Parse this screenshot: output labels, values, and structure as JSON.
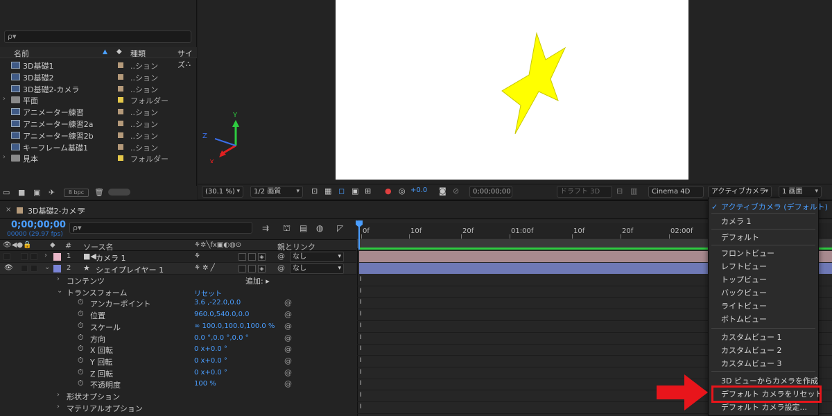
{
  "project": {
    "search_icon": "ρ▾",
    "columns": {
      "name": "名前",
      "type": "種類",
      "size": "サイズ"
    },
    "items": [
      {
        "name": "3D基礎1",
        "type": "..ション",
        "icon": "comp",
        "label_color": "#b59a7a"
      },
      {
        "name": "3D基礎2",
        "type": "..ション",
        "icon": "comp",
        "label_color": "#b59a7a"
      },
      {
        "name": "3D基礎2-カメラ",
        "type": "..ション",
        "icon": "comp",
        "label_color": "#b59a7a"
      },
      {
        "name": "平面",
        "type": "フォルダー",
        "icon": "folder",
        "label_color": "#e6c94a"
      },
      {
        "name": "アニメーター練習",
        "type": "..ション",
        "icon": "comp",
        "label_color": "#b59a7a"
      },
      {
        "name": "アニメーター練習2a",
        "type": "..ション",
        "icon": "comp",
        "label_color": "#b59a7a"
      },
      {
        "name": "アニメーター練習2b",
        "type": "..ション",
        "icon": "comp",
        "label_color": "#b59a7a"
      },
      {
        "name": "キーフレーム基礎1",
        "type": "..ション",
        "icon": "comp",
        "label_color": "#b59a7a"
      },
      {
        "name": "見本",
        "type": "フォルダー",
        "icon": "folder",
        "label_color": "#e6c94a"
      }
    ],
    "bpc": "8 bpc"
  },
  "viewer": {
    "axis_y": "Y",
    "axis_z": "Z",
    "axis_x": "X",
    "zoom": "(30.1 %)",
    "resolution": "1/2 画質",
    "exposure": "+0.0",
    "timecode": "0;00;00;00",
    "draft3d": "ドラフト 3D",
    "renderer": "Cinema 4D",
    "camera": "アクティブカメラ",
    "views": "1 画面"
  },
  "timeline": {
    "tab_title": "3D基礎2-カメラ",
    "timecode": "0;00;00;00",
    "fps": "00000 (29.97 fps)",
    "search_icon": "ρ▾",
    "header": {
      "source_name": "ソース名",
      "parent_link": "親とリンク",
      "num": "#"
    },
    "layers": [
      {
        "num": "1",
        "name": "カメラ 1",
        "icon": "■◀",
        "label_color": "#e9b7c8",
        "parent": "なし"
      },
      {
        "num": "2",
        "name": "シェイプレイヤー 1",
        "icon": "★",
        "label_color": "#7a84d6",
        "parent": "なし"
      }
    ],
    "props": [
      {
        "name": "コンテンツ",
        "indent": 1,
        "value": "",
        "add": "追加:"
      },
      {
        "name": "トランスフォーム",
        "indent": 1,
        "value": "リセット",
        "open": true
      },
      {
        "name": "アンカーポイント",
        "indent": 2,
        "value": "3.6 ,-22.0,0.0",
        "watch": true
      },
      {
        "name": "位置",
        "indent": 2,
        "value": "960.0,540.0,0.0",
        "watch": true
      },
      {
        "name": "スケール",
        "indent": 2,
        "value": "∞ 100.0,100.0,100.0 %",
        "watch": true
      },
      {
        "name": "方向",
        "indent": 2,
        "value": "0.0 °,0.0 °,0.0 °",
        "watch": true
      },
      {
        "name": "X 回転",
        "indent": 2,
        "value": "0 x+0.0 °",
        "watch": true
      },
      {
        "name": "Y 回転",
        "indent": 2,
        "value": "0 x+0.0 °",
        "watch": true
      },
      {
        "name": "Z 回転",
        "indent": 2,
        "value": "0 x+0.0 °",
        "watch": true
      },
      {
        "name": "不透明度",
        "indent": 2,
        "value": "100 %",
        "watch": true
      },
      {
        "name": "形状オプション",
        "indent": 1,
        "value": ""
      },
      {
        "name": "マテリアルオプション",
        "indent": 1,
        "value": ""
      }
    ],
    "ruler": [
      "0f",
      "10f",
      "20f",
      "01:00f",
      "10f",
      "20f",
      "02:00f"
    ]
  },
  "menu": {
    "items": [
      {
        "label": "アクティブカメラ (デフォルト)",
        "selected": true
      },
      {
        "label": "カメラ 1"
      },
      {
        "label": "デフォルト"
      },
      {
        "label": "フロントビュー"
      },
      {
        "label": "レフトビュー"
      },
      {
        "label": "トップビュー"
      },
      {
        "label": "バックビュー"
      },
      {
        "label": "ライトビュー"
      },
      {
        "label": "ボトムビュー"
      },
      {
        "label": "カスタムビュー 1"
      },
      {
        "label": "カスタムビュー 2"
      },
      {
        "label": "カスタムビュー 3"
      },
      {
        "label": "3D ビューからカメラを作成"
      },
      {
        "label": "デフォルト カメラをリセット",
        "highlighted": true
      },
      {
        "label": "デフォルト カメラ設定..."
      }
    ]
  },
  "colors": {
    "accent": "#4a9eff",
    "highlight": "#e8151b",
    "star": "#ffff00"
  }
}
